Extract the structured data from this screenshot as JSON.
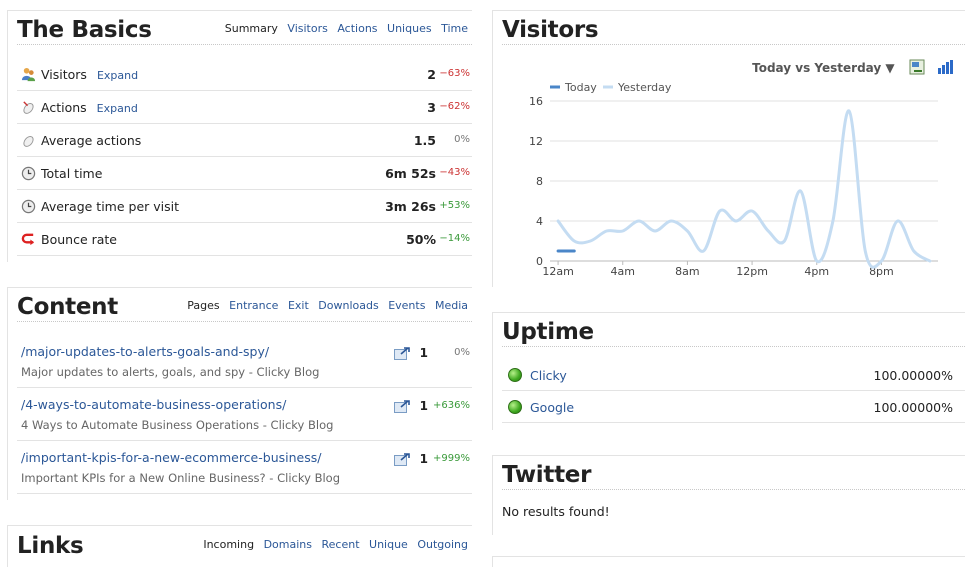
{
  "basics": {
    "title": "The Basics",
    "tabs": [
      "Summary",
      "Visitors",
      "Actions",
      "Uniques",
      "Time"
    ],
    "rows": [
      {
        "icon": "visitors-icon",
        "label": "Visitors",
        "expand": "Expand",
        "value": "2",
        "change": "−63%",
        "trend": "neg"
      },
      {
        "icon": "actions-icon",
        "label": "Actions",
        "expand": "Expand",
        "value": "3",
        "change": "−62%",
        "trend": "neg"
      },
      {
        "icon": "average-actions-icon",
        "label": "Average actions",
        "expand": "",
        "value": "1.5",
        "change": "0%",
        "trend": "zero"
      },
      {
        "icon": "clock-icon",
        "label": "Total time",
        "expand": "",
        "value": "6m 52s",
        "change": "−43%",
        "trend": "neg"
      },
      {
        "icon": "clock-icon",
        "label": "Average time per visit",
        "expand": "",
        "value": "3m 26s",
        "change": "+53%",
        "trend": "pos"
      },
      {
        "icon": "bounce-icon",
        "label": "Bounce rate",
        "expand": "",
        "value": "50%",
        "change": "−14%",
        "trend": "pos"
      }
    ]
  },
  "content": {
    "title": "Content",
    "tabs": [
      "Pages",
      "Entrance",
      "Exit",
      "Downloads",
      "Events",
      "Media"
    ],
    "rows": [
      {
        "url": "/major-updates-to-alerts-goals-and-spy/",
        "page_title": "Major updates to alerts, goals, and spy - Clicky Blog",
        "count": "1",
        "change": "0%",
        "trend": "zero"
      },
      {
        "url": "/4-ways-to-automate-business-operations/",
        "page_title": "4 Ways to Automate Business Operations - Clicky Blog",
        "count": "1",
        "change": "+636%",
        "trend": "pos"
      },
      {
        "url": "/important-kpis-for-a-new-ecommerce-business/",
        "page_title": "Important KPIs for a New Online Business? - Clicky Blog",
        "count": "1",
        "change": "+999%",
        "trend": "pos"
      }
    ]
  },
  "links": {
    "title": "Links",
    "tabs": [
      "Incoming",
      "Domains",
      "Recent",
      "Unique",
      "Outgoing"
    ]
  },
  "visitors": {
    "title": "Visitors",
    "compare_label": "Today vs Yesterday ▼",
    "icons": [
      "export-icon",
      "bar-chart-icon"
    ]
  },
  "chart_data": {
    "type": "line",
    "series": [
      {
        "name": "Today",
        "color": "#4a86c8",
        "x": [
          0,
          1
        ],
        "values": [
          1,
          1
        ]
      },
      {
        "name": "Yesterday",
        "color": "#c4dcf2",
        "x": [
          0,
          1,
          2,
          3,
          4,
          5,
          6,
          7,
          8,
          9,
          10,
          11,
          12,
          13,
          14,
          15,
          16,
          17,
          18,
          19,
          20,
          21,
          22,
          23
        ],
        "values": [
          4,
          2,
          2,
          3,
          3,
          4,
          3,
          4,
          3,
          1,
          5,
          4,
          5,
          3,
          2,
          7,
          0,
          4,
          15,
          1,
          0,
          4,
          1,
          0
        ]
      }
    ],
    "x_tick_labels": [
      "12am",
      "4am",
      "8am",
      "12pm",
      "4pm",
      "8pm"
    ],
    "x_tick_positions": [
      0,
      4,
      8,
      12,
      16,
      20
    ],
    "y_ticks": [
      0,
      4,
      8,
      12,
      16
    ],
    "ylim": [
      0,
      16
    ],
    "xlim": [
      -0.5,
      23.5
    ],
    "grid": true,
    "legend_position": "top-left"
  },
  "uptime": {
    "title": "Uptime",
    "rows": [
      {
        "name": "Clicky",
        "value": "100.00000%"
      },
      {
        "name": "Google",
        "value": "100.00000%"
      }
    ]
  },
  "twitter": {
    "title": "Twitter",
    "message": "No results found!"
  }
}
